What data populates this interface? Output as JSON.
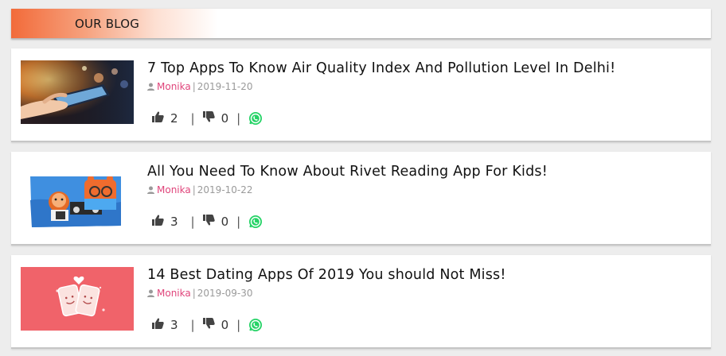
{
  "header": {
    "title": "OUR BLOG"
  },
  "posts": [
    {
      "title": "7 Top Apps To Know Air Quality Index And Pollution Level In Delhi!",
      "author": "Monika",
      "date": "2019-11-20",
      "likes": "2",
      "dislikes": "0"
    },
    {
      "title": "All You Need To Know About Rivet Reading App For Kids!",
      "author": "Monika",
      "date": "2019-10-22",
      "likes": "3",
      "dislikes": "0"
    },
    {
      "title": "14 Best Dating Apps Of 2019 You should Not Miss!",
      "author": "Monika",
      "date": "2019-09-30",
      "likes": "3",
      "dislikes": "0"
    }
  ],
  "colors": {
    "accent": "#f26b3a",
    "author": "#e0457b",
    "whatsapp": "#25d366"
  },
  "icons": [
    "user-icon",
    "thumbs-up-icon",
    "thumbs-down-icon",
    "whatsapp-icon"
  ]
}
